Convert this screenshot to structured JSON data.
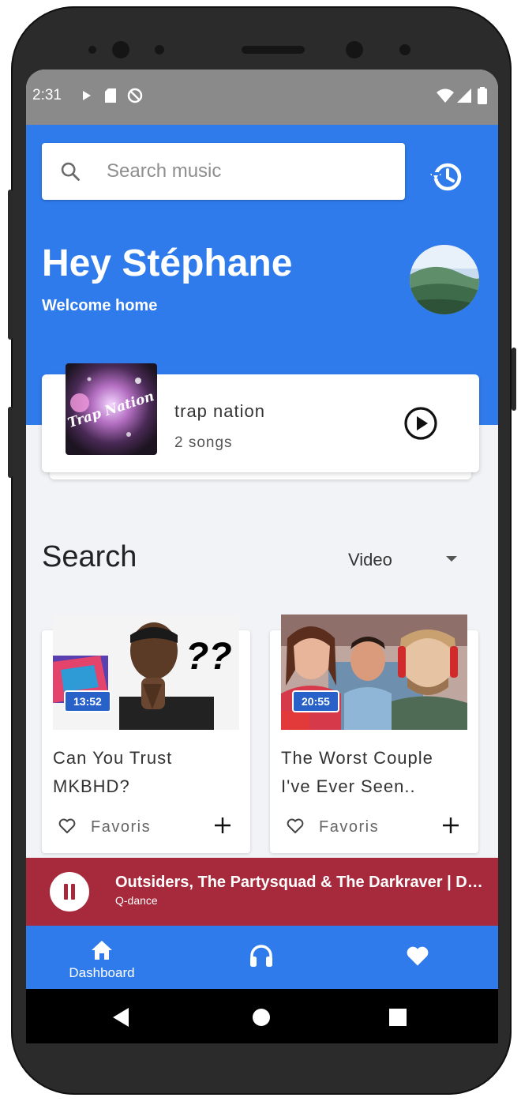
{
  "status_bar": {
    "time": "2:31"
  },
  "search": {
    "placeholder": "Search music"
  },
  "greeting": {
    "title": "Hey Stéphane",
    "subtitle": "Welcome home"
  },
  "playlist_card": {
    "title": "trap nation",
    "songs": "2 songs",
    "album_text": "Trap Nation"
  },
  "section": {
    "title": "Search",
    "filter_value": "Video"
  },
  "videos": [
    {
      "duration": "13:52",
      "title": "Can You Trust MKBHD?",
      "favorite_label": "Favoris",
      "thumb_text": "??"
    },
    {
      "duration": "20:55",
      "title": "The Worst Couple I've Ever Seen..",
      "favorite_label": "Favoris"
    }
  ],
  "now_playing": {
    "title": "Outsiders, The Partysquad & The Darkraver | Def…",
    "artist": "Q-dance"
  },
  "bottom_nav": {
    "items": [
      {
        "icon": "home-icon",
        "label": "Dashboard"
      },
      {
        "icon": "headphones-icon",
        "label": ""
      },
      {
        "icon": "heart-icon",
        "label": ""
      }
    ]
  },
  "colors": {
    "primary": "#2f7bec",
    "player": "#a62a3c",
    "status_bar": "#8a8a8a"
  }
}
